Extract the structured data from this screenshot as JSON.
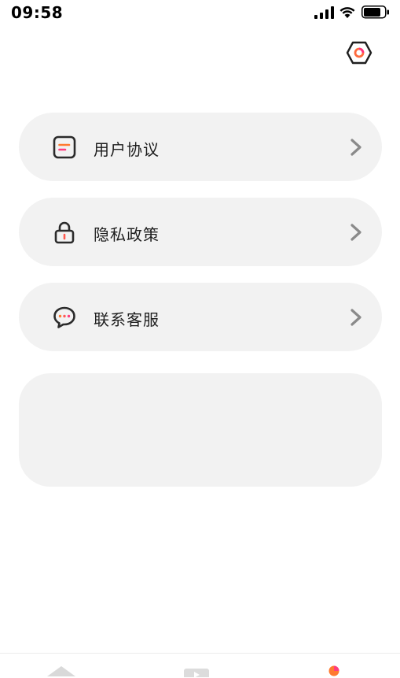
{
  "status_bar": {
    "time": "09:58"
  },
  "header": {
    "settings_icon": "hexagon-settings-icon"
  },
  "menu": {
    "items": [
      {
        "label": "用户协议",
        "icon": "document-icon"
      },
      {
        "label": "隐私政策",
        "icon": "lock-icon"
      },
      {
        "label": "联系客服",
        "icon": "chat-bubble-icon"
      }
    ]
  },
  "tab_bar": {
    "tabs": [
      {
        "icon": "home-icon"
      },
      {
        "icon": "video-icon"
      },
      {
        "icon": "profile-icon"
      }
    ]
  },
  "colors": {
    "card_background": "#f2f2f2",
    "accent_orange": "#ff7a2f",
    "accent_pink": "#ff3d7f",
    "icon_dark": "#2b2b2b",
    "chevron_gray": "#8a8a8a"
  }
}
